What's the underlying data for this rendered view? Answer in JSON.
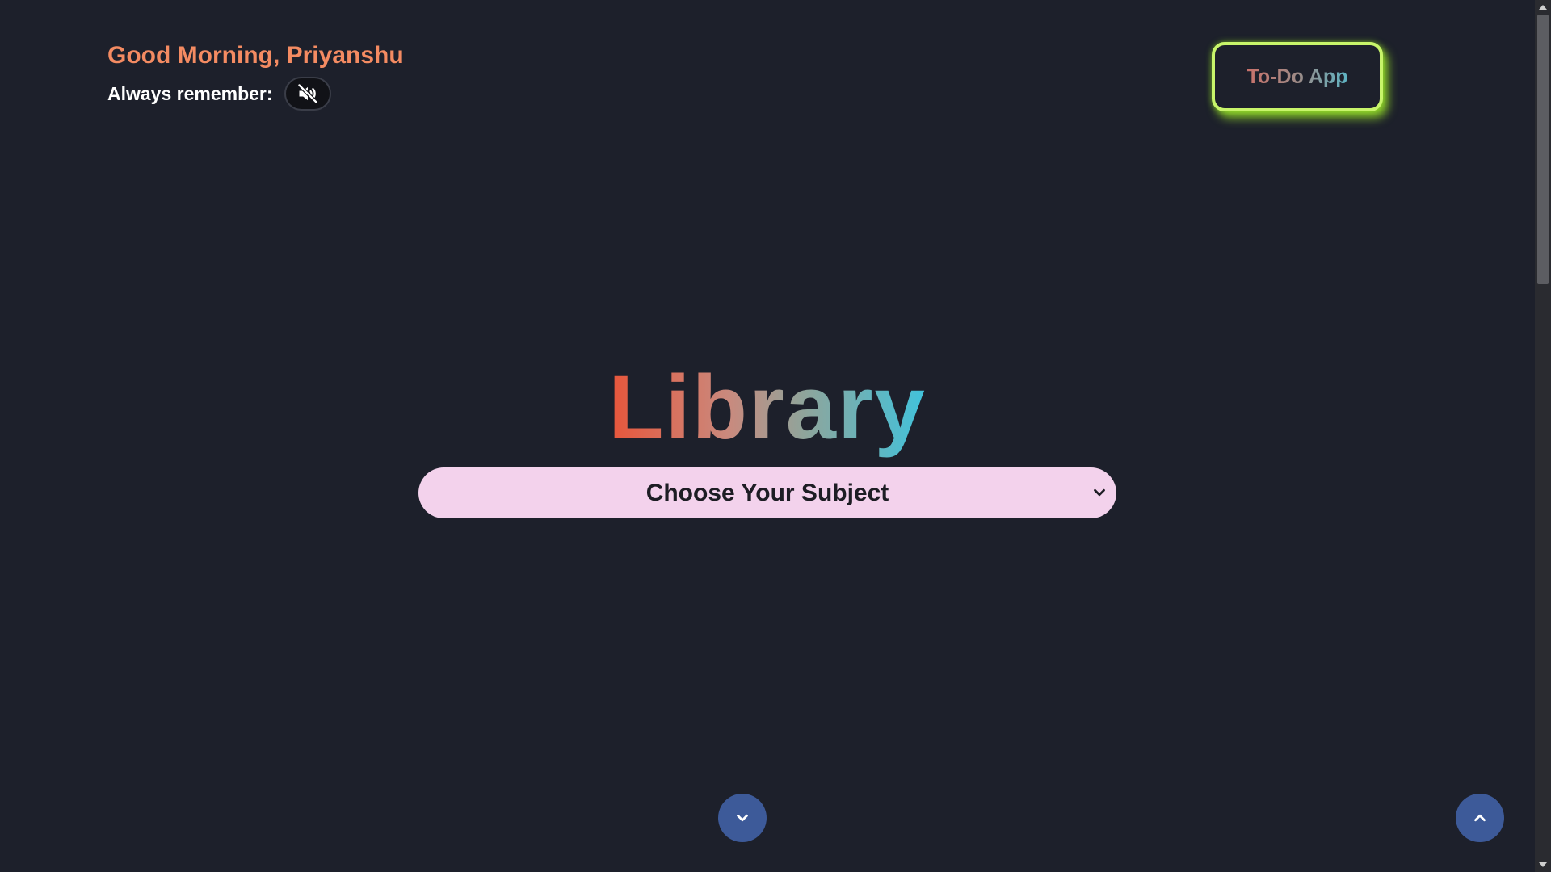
{
  "header": {
    "greeting": "Good Morning, Priyanshu",
    "remember_label": "Always remember:",
    "mute_icon": "speaker-muted-icon",
    "todo_label": "To-Do App"
  },
  "main": {
    "title": "Library",
    "subject_select": {
      "selected": "Choose Your Subject",
      "chevron_icon": "chevron-down-icon"
    }
  },
  "footer": {
    "scroll_down_icon": "chevron-down-icon",
    "scroll_top_icon": "chevron-up-icon"
  },
  "colors": {
    "background": "#1d202b",
    "greeting": "#f48b62",
    "todo_border": "#c8f56a",
    "select_bg": "#f3d2ec",
    "fab_bg": "#3d5a99"
  }
}
